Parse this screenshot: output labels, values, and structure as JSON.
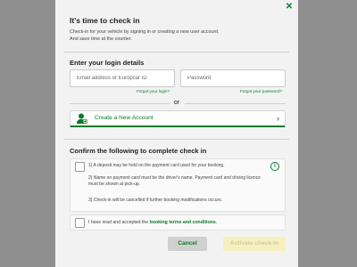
{
  "intro": {
    "title": "It's time to check in",
    "text_line1": "Check-in for your vehicle by signing in or creating a new user account.",
    "text_line2": "And save time at the counter."
  },
  "login": {
    "title": "Enter your login details",
    "email_placeholder": "Email address or Europcar ID",
    "email_value": "",
    "password_placeholder": "Password",
    "password_value": "",
    "forgot_login": "Forgot your login?",
    "forgot_password": "Forgot your password?",
    "or_label": "or",
    "create_account_label": "Create a New Account"
  },
  "confirm": {
    "title": "Confirm the following to complete check in",
    "terms": [
      "1) A deposit may be held on the payment card used for your booking.",
      "2) Name on payment card must be the driver's name. Payment card and driving licence must be shown at pick-up.",
      "3) Check-in will be cancelled if further booking modifications occurs."
    ],
    "accept_prefix": "I have read and accepted the ",
    "accept_link": "booking terms and conditions",
    "accept_suffix": "."
  },
  "buttons": {
    "cancel": "Cancel",
    "activate": "Activate check-in"
  },
  "icons": {
    "close": "close-icon",
    "user_add": "user-add-icon",
    "chevron": "chevron-right-icon",
    "info": "info-icon"
  },
  "colors": {
    "accent": "#0a7a2b",
    "overlay": "#8f8f8f",
    "modal_bg": "#f2f2f2",
    "activate_disabled_bg": "#f5f0bd"
  }
}
